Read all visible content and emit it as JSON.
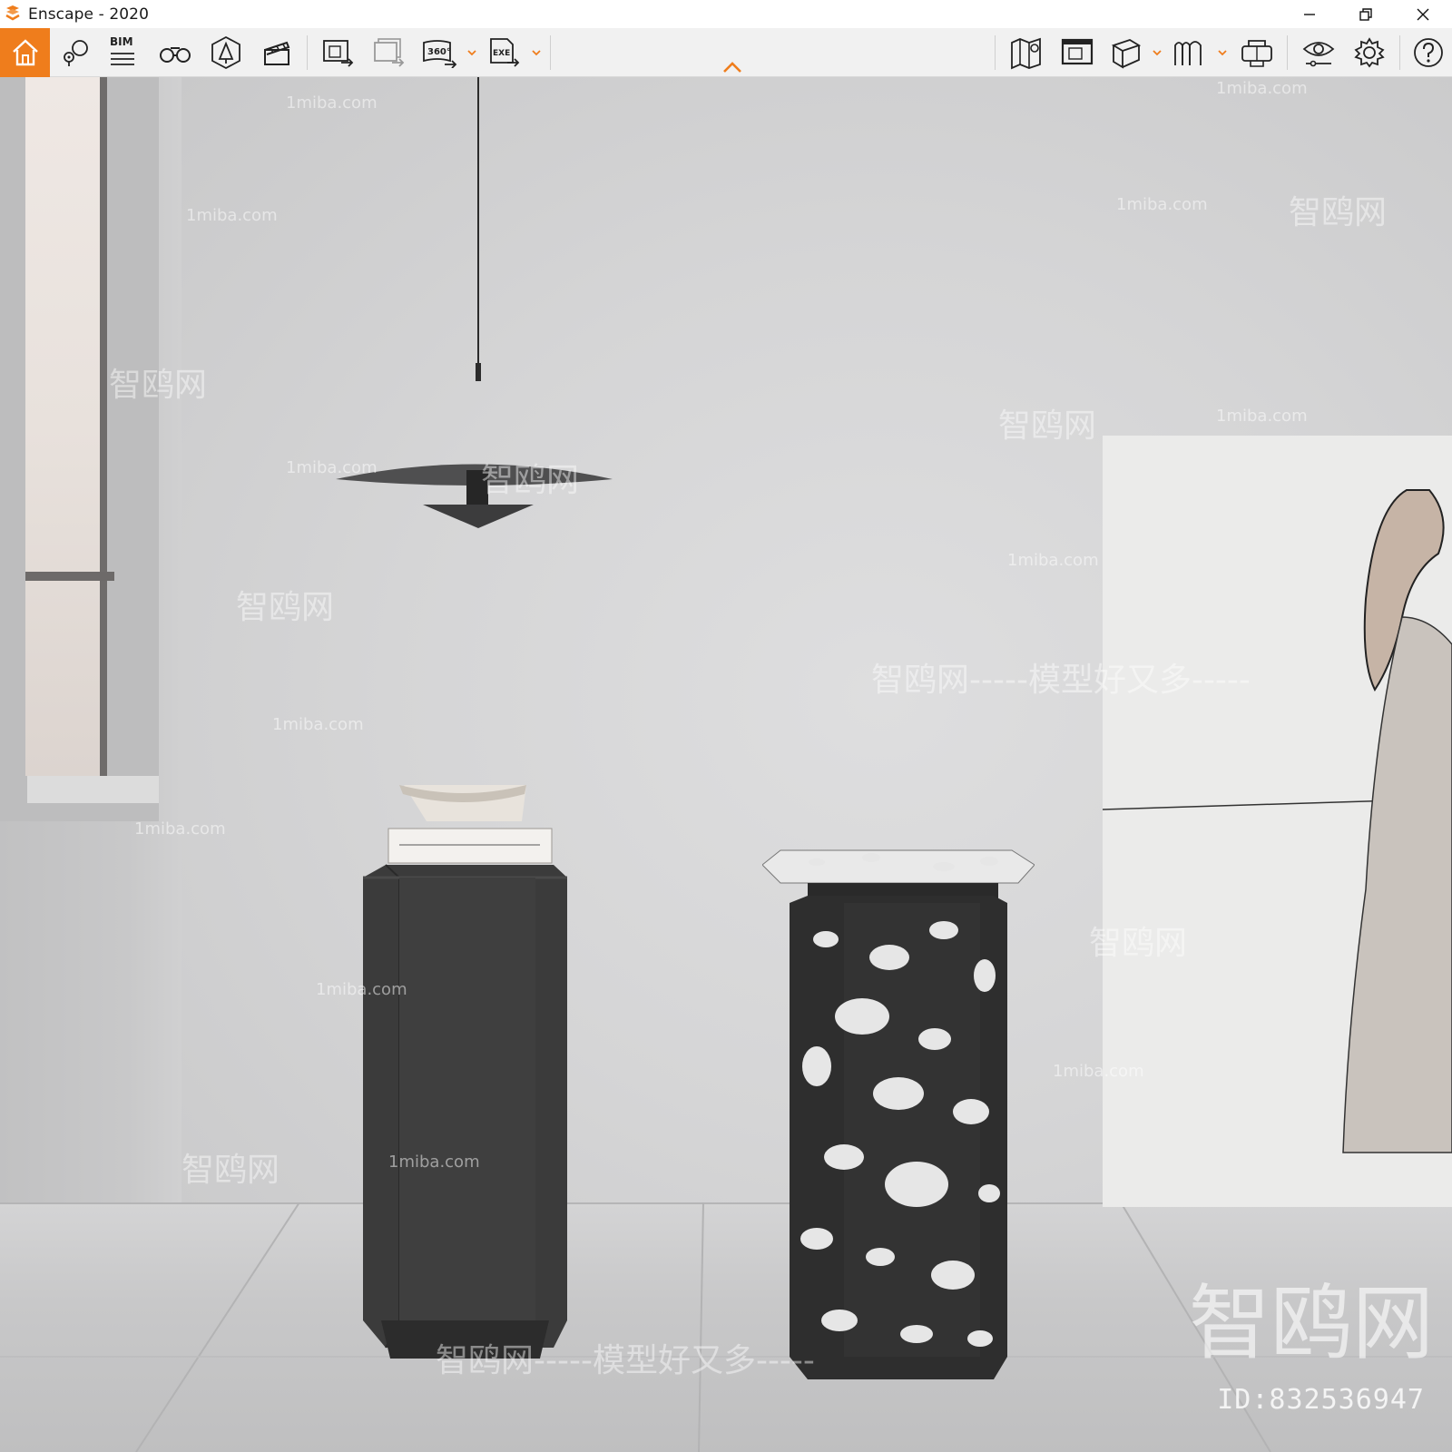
{
  "window": {
    "title": "Enscape - 2020",
    "minimize_icon": "minimize-icon",
    "maximize_icon": "restore-icon",
    "close_icon": "close-icon"
  },
  "toolbar": {
    "accent_color": "#ef7d1c",
    "bim_label": "BIM",
    "left_group": [
      {
        "icon": "home-icon",
        "active": true
      },
      {
        "icon": "map-pin-view-icon"
      },
      {
        "icon": "bim-list-icon"
      },
      {
        "icon": "binoculars-icon"
      },
      {
        "icon": "asset-library-icon"
      },
      {
        "icon": "clapperboard-icon"
      }
    ],
    "export_group": [
      {
        "icon": "export-image-icon"
      },
      {
        "icon": "batch-export-icon"
      },
      {
        "icon": "export-360-icon",
        "label": "360°",
        "has_dropdown": true
      },
      {
        "icon": "export-exe-icon",
        "label": "EXE",
        "has_dropdown": true
      }
    ],
    "right_group": [
      {
        "icon": "map-icon"
      },
      {
        "icon": "minimap-icon"
      },
      {
        "icon": "cube-icon",
        "has_dropdown": true
      },
      {
        "icon": "hands-icon",
        "has_dropdown": true
      },
      {
        "icon": "vr-headset-icon"
      },
      {
        "icon": "eye-visual-settings-icon"
      },
      {
        "icon": "gear-icon"
      },
      {
        "icon": "help-icon"
      }
    ],
    "collapse_icon": "chevron-up-icon"
  },
  "viewport": {
    "watermark_brand": "智鸥网",
    "watermark_slogan": "智鸥网-----模型好又多-----",
    "watermark_url": "1miba.com",
    "id_label": "ID:832536947"
  }
}
